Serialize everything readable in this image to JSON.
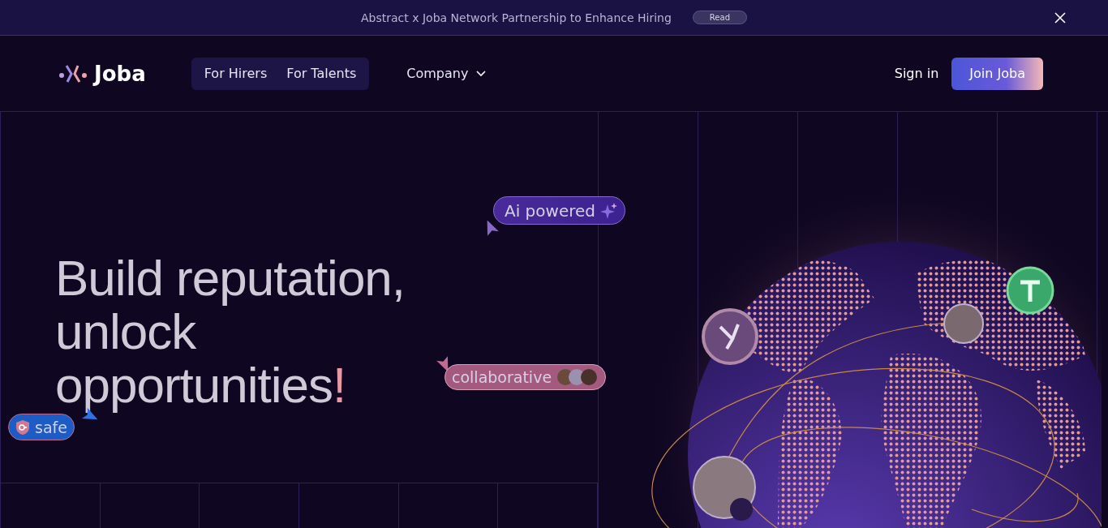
{
  "announcement": {
    "text": "Abstract x Joba Network Partnership to Enhance Hiring",
    "action": "Read"
  },
  "nav": {
    "logo": "Joba",
    "tabs": [
      {
        "label": "For Hirers"
      },
      {
        "label": "For Talents"
      }
    ],
    "menu": "Company",
    "sign_in": "Sign in",
    "cta": "Join Joba"
  },
  "hero": {
    "headline_lines": [
      "Build reputation,",
      "unlock",
      "opportunities"
    ],
    "accent": "!",
    "badges": [
      {
        "kind": "ai",
        "label": "Ai powered"
      },
      {
        "kind": "collab",
        "label": "collaborative"
      },
      {
        "kind": "safe",
        "label": "safe"
      }
    ]
  }
}
